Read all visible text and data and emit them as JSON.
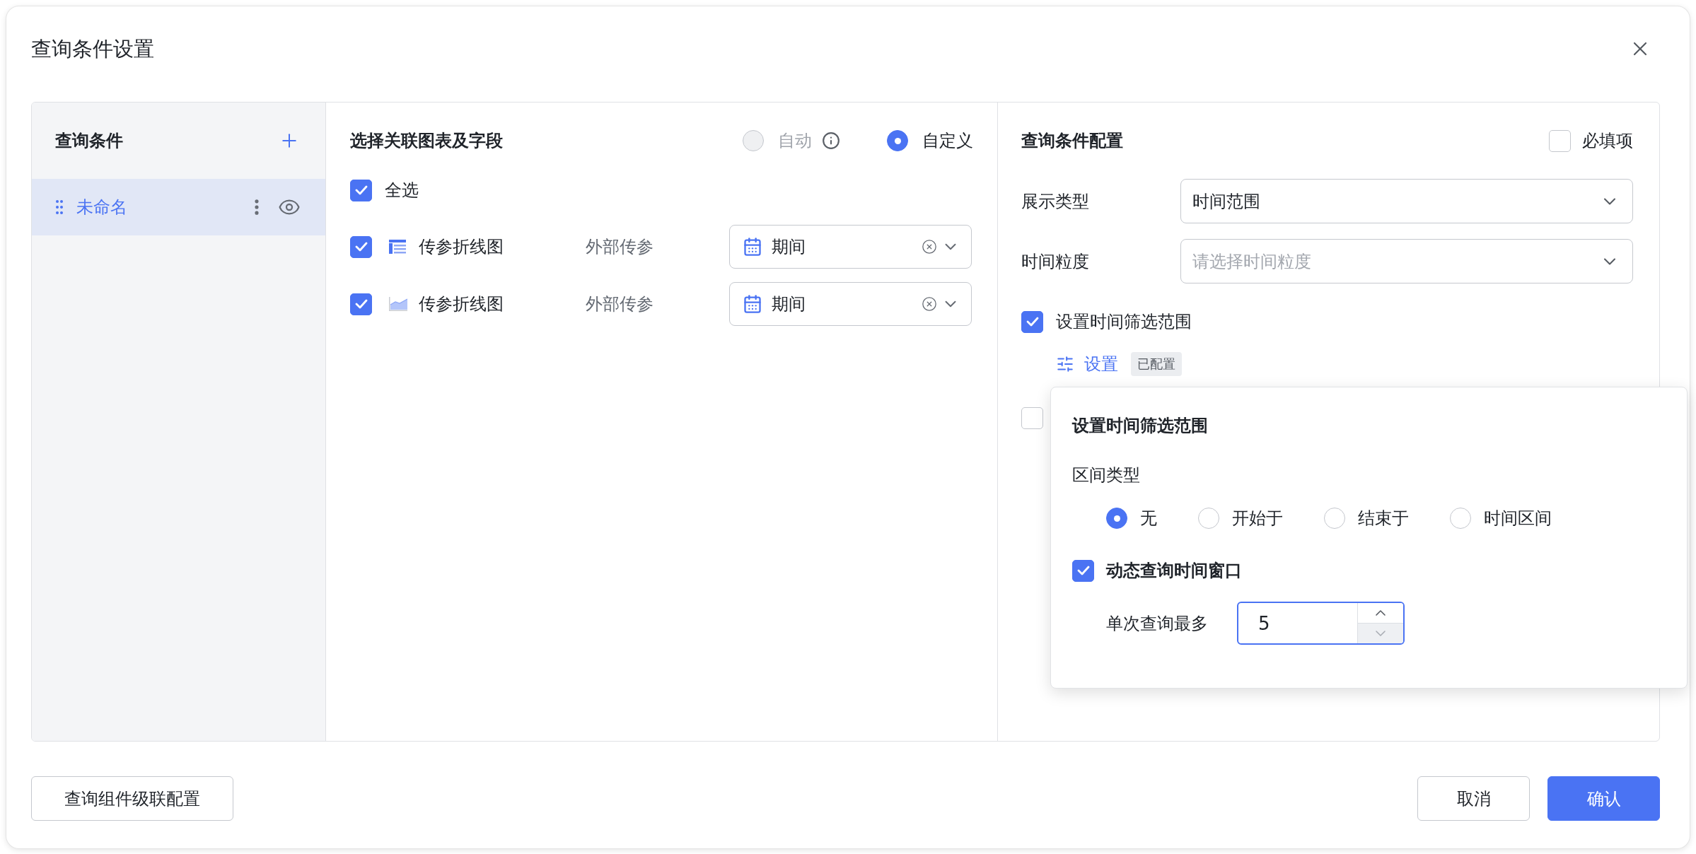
{
  "dialog": {
    "title": "查询条件设置"
  },
  "conditions_panel": {
    "title": "查询条件",
    "items": [
      {
        "label": "未命名",
        "selected": true
      }
    ]
  },
  "link_panel": {
    "title": "选择关联图表及字段",
    "modes": [
      {
        "label": "自动",
        "selected": false,
        "disabled": true,
        "info": true
      },
      {
        "label": "自定义",
        "selected": true,
        "disabled": false
      }
    ],
    "select_all": {
      "label": "全选",
      "checked": true
    },
    "rows": [
      {
        "kind": "table",
        "checked": true,
        "name": "传参折线图",
        "source": "外部传参",
        "field": "期间"
      },
      {
        "kind": "area",
        "checked": true,
        "name": "传参折线图",
        "source": "外部传参",
        "field": "期间"
      }
    ]
  },
  "config_panel": {
    "title": "查询条件配置",
    "required": {
      "label": "必填项",
      "checked": false
    },
    "fields": [
      {
        "label": "展示类型",
        "value": "时间范围"
      },
      {
        "label": "时间粒度",
        "placeholder": "请选择时间粒度"
      }
    ],
    "time_range": {
      "label": "设置时间筛选范围",
      "checked": true,
      "link": "设置",
      "tag": "已配置"
    },
    "covered_option": {
      "checked": false
    }
  },
  "time_range_popover": {
    "title": "设置时间筛选范围",
    "range_type": {
      "label": "区间类型",
      "options": [
        {
          "label": "无",
          "selected": true
        },
        {
          "label": "开始于",
          "selected": false
        },
        {
          "label": "结束于",
          "selected": false
        },
        {
          "label": "时间区间",
          "selected": false
        }
      ]
    },
    "dynamic_window": {
      "label": "动态查询时间窗口",
      "checked": true
    },
    "max_per_query": {
      "label": "单次查询最多",
      "value": "5"
    }
  },
  "footer": {
    "cascade_button": "查询组件级联配置",
    "cancel_button": "取消",
    "confirm_button": "确认"
  }
}
